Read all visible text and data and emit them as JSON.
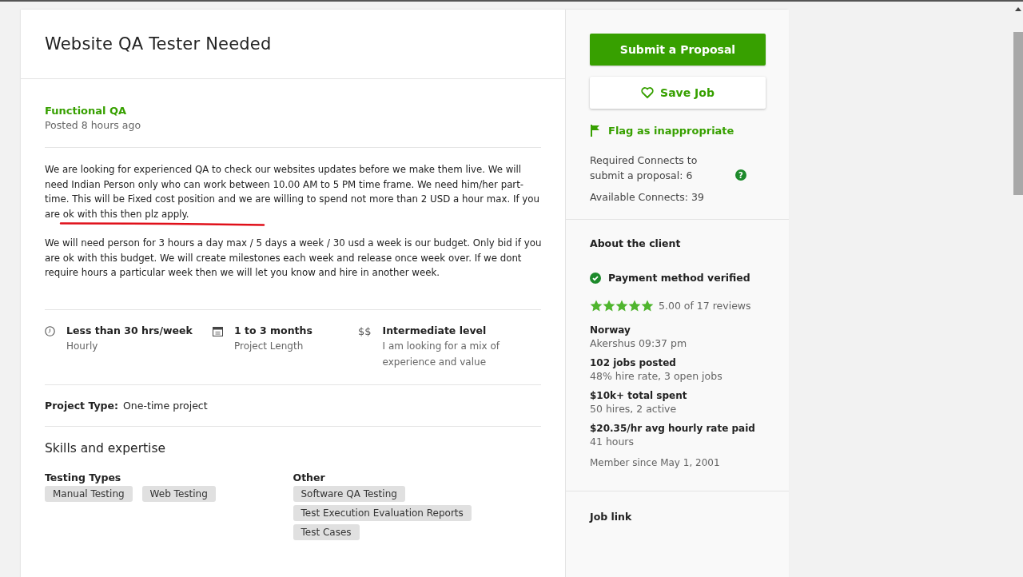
{
  "job": {
    "title": "Website QA Tester Needed",
    "category": "Functional QA",
    "posted": "Posted 8 hours ago",
    "description": [
      "We are looking for experienced QA to check our websites updates before we make them live.  We will need Indian Person only who can work between 10.00 AM to 5 PM time frame.  We need him/her part-time.  This will be Fixed cost position and we are willing to spend not more than 2 USD a hour max.  If you are ok with this then plz apply.",
      "We will need person for 3 hours a day max / 5 days a week / 30 usd a week is our budget.  Only bid if you are ok with this budget.  We will create milestones each week and release once week over.  If we dont require hours a particular week then we will let you know and hire in another week."
    ],
    "features": [
      {
        "kind": "clock",
        "title": "Less than 30 hrs/week",
        "detail": "Hourly"
      },
      {
        "kind": "calendar",
        "title": "1 to 3 months",
        "detail": "Project Length"
      },
      {
        "kind": "dollars",
        "icon_text": "$$",
        "title": "Intermediate level",
        "detail": "I am looking for a mix of experience and value"
      }
    ],
    "project_type": {
      "label": "Project Type:",
      "value": "One-time project"
    },
    "skills": {
      "heading": "Skills and expertise",
      "groups": [
        {
          "name": "Testing Types",
          "tags": [
            "Manual Testing",
            "Web Testing"
          ]
        },
        {
          "name": "Other",
          "tags": [
            "Software QA Testing",
            "Test Execution Evaluation Reports",
            "Test Cases"
          ]
        }
      ]
    }
  },
  "sidebar": {
    "submit": "Submit a Proposal",
    "save": "Save Job",
    "flag": "Flag as inappropriate",
    "required_connects": "Required Connects to submit a proposal: 6",
    "help_icon_text": "?",
    "available_connects": "Available Connects: 39",
    "client": {
      "heading": "About the client",
      "payment": "Payment method verified",
      "stars": 5,
      "rating": "5.00 of 17 reviews",
      "facts": [
        {
          "title": "Norway",
          "detail": "Akershus 09:37 pm"
        },
        {
          "title": "102 jobs posted",
          "detail": "48% hire rate, 3 open jobs"
        },
        {
          "title": "$10k+ total spent",
          "detail": "50 hires, 2 active"
        },
        {
          "title": "$20.35/hr avg hourly rate paid",
          "detail": "41 hours"
        }
      ],
      "member_since": "Member since May 1, 2001"
    },
    "job_link": "Job link"
  }
}
